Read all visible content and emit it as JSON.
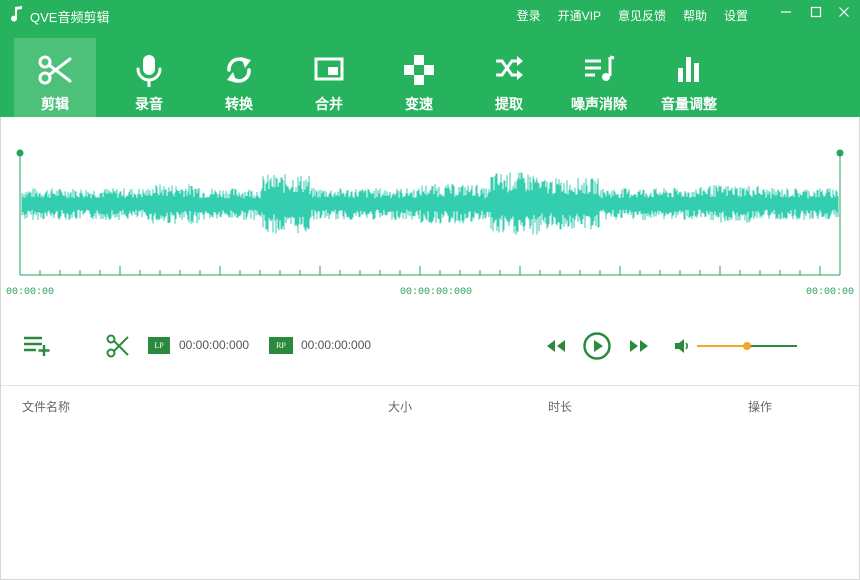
{
  "app": {
    "title": "QVE音频剪辑",
    "top_links": [
      "登录",
      "开通VIP",
      "意见反馈",
      "帮助",
      "设置"
    ]
  },
  "toolbar": {
    "active_index": 0,
    "tools": [
      {
        "label": "剪辑",
        "icon": "scissors-icon"
      },
      {
        "label": "录音",
        "icon": "microphone-icon"
      },
      {
        "label": "转换",
        "icon": "convert-icon"
      },
      {
        "label": "合并",
        "icon": "merge-icon"
      },
      {
        "label": "变速",
        "icon": "speed-icon"
      },
      {
        "label": "提取",
        "icon": "shuffle-icon"
      },
      {
        "label": "噪声消除",
        "icon": "noise-icon"
      },
      {
        "label": "音量调整",
        "icon": "volume-bars-icon"
      }
    ]
  },
  "waveform": {
    "color": "#33cdb0",
    "marker_color": "#27a35a",
    "start_time": "00:00:00",
    "mid_time": "00:00:00:000",
    "end_time": "00:00:00"
  },
  "controls": {
    "lp_label": "LP",
    "lp_time": "00:00:00:000",
    "rp_label": "RP",
    "rp_time": "00:00:00:000",
    "volume_fraction": 0.5
  },
  "file_list": {
    "columns": [
      "文件名称",
      "大小",
      "时长",
      "操作"
    ]
  },
  "colors": {
    "brand": "#27b35d",
    "accent": "#f5a623"
  }
}
